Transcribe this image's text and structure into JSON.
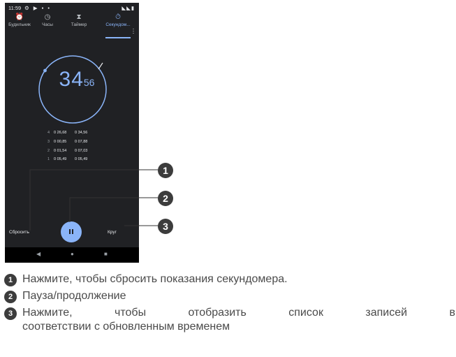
{
  "status_bar": {
    "time": "11:59",
    "left_icons": "⚙ ▶ ▪ •",
    "right_icons": "◣◣▮"
  },
  "tabs": [
    {
      "label": "Будильник",
      "icon": "alarm-icon"
    },
    {
      "label": "Часы",
      "icon": "clock-icon"
    },
    {
      "label": "Таймер",
      "icon": "hourglass-icon"
    },
    {
      "label": "Секундом...",
      "icon": "stopwatch-icon"
    }
  ],
  "active_tab_index": 3,
  "stopwatch": {
    "seconds": "34",
    "hundredths": "56"
  },
  "laps": [
    {
      "n": "4",
      "lap": "0 26,68",
      "total": "0 34,56"
    },
    {
      "n": "3",
      "lap": "0 00,85",
      "total": "0 07,88"
    },
    {
      "n": "2",
      "lap": "0 01,54",
      "total": "0 07,03"
    },
    {
      "n": "1",
      "lap": "0 05,49",
      "total": "0 05,49"
    }
  ],
  "buttons": {
    "reset": "Сбросить",
    "lap": "Круг"
  },
  "callouts": [
    "1",
    "2",
    "3"
  ],
  "legend": [
    {
      "num": "1",
      "text": "Нажмите, чтобы сбросить показания секундомера."
    },
    {
      "num": "2",
      "text": "Пауза/продолжение"
    },
    {
      "num": "3",
      "line1": "Нажмите, чтобы отобразить список записей в",
      "line2": "соответствии с обновленным временем"
    }
  ],
  "colors": {
    "accent": "#8ab4f8",
    "background": "#202124",
    "badge": "#3c3c3c"
  }
}
